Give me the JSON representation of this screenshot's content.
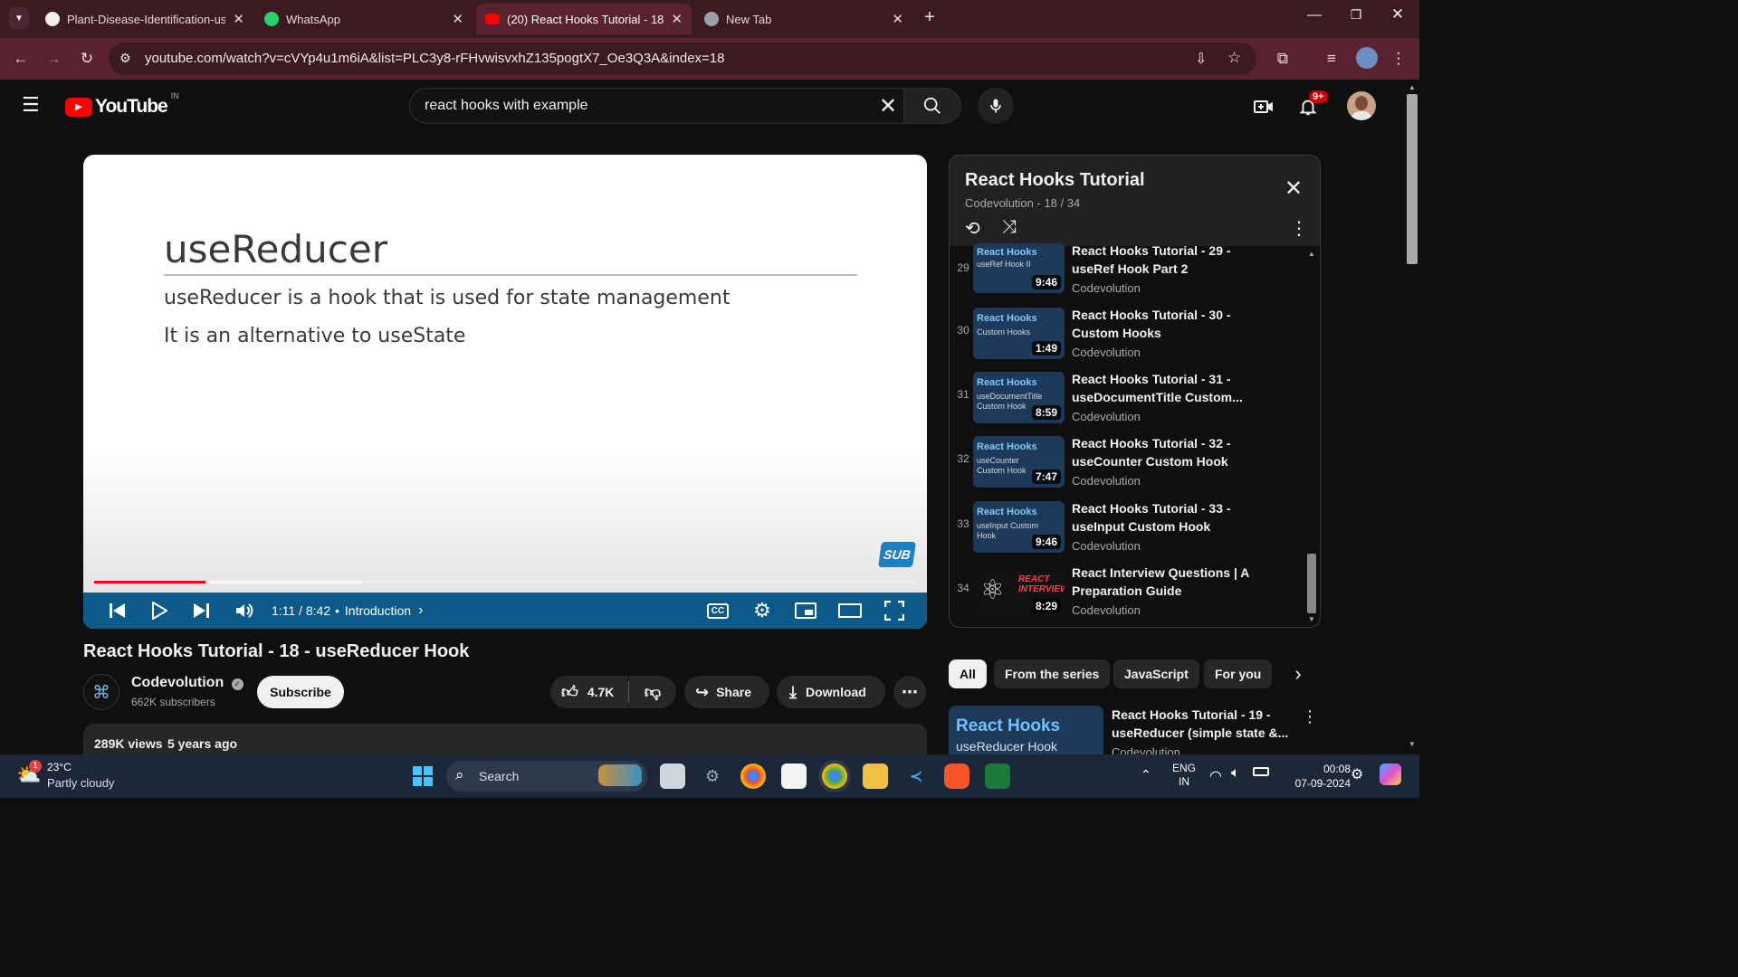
{
  "browser": {
    "tabs": [
      {
        "title": "Plant-Disease-Identification-usi",
        "icon": "github-icon"
      },
      {
        "title": "WhatsApp",
        "icon": "whatsapp-icon"
      },
      {
        "title": "(20) React Hooks Tutorial - 18 -",
        "icon": "youtube-icon"
      },
      {
        "title": "New Tab",
        "icon": "chrome-icon"
      }
    ],
    "url": "youtube.com/watch?v=cVYp4u1m6iA&list=PLC3y8-rFHvwisvxhZ135pogtX7_Oe3Q3A&index=18"
  },
  "header": {
    "logo_text": "YouTube",
    "region": "IN",
    "search_value": "react hooks with example",
    "notification_badge": "9+"
  },
  "player": {
    "slide_title": "useReducer",
    "slide_line1": "useReducer is a hook that is used for state management",
    "slide_line2": "It is an alternative to useState",
    "time": "1:11 / 8:42",
    "chapter": "Introduction",
    "watermark": "SUB",
    "progress": 0.136,
    "buffered": 0.325
  },
  "video": {
    "title": "React Hooks Tutorial - 18 - useReducer Hook",
    "channel": "Codevolution",
    "subscribers": "662K subscribers",
    "subscribe_label": "Subscribe",
    "likes": "4.7K",
    "share_label": "Share",
    "download_label": "Download",
    "views": "289K views",
    "age": "5 years ago"
  },
  "playlist": {
    "title": "React Hooks Tutorial",
    "meta": "Codevolution - 18 / 34",
    "items": [
      {
        "num": "29",
        "thumb_title": "React Hooks",
        "thumb_sub": "useRef Hook II",
        "duration": "9:46",
        "title": "React Hooks Tutorial - 29 - useRef Hook Part 2",
        "channel": "Codevolution"
      },
      {
        "num": "30",
        "thumb_title": "React Hooks",
        "thumb_sub": "Custom Hooks",
        "duration": "1:49",
        "title": "React Hooks Tutorial - 30 - Custom Hooks",
        "channel": "Codevolution"
      },
      {
        "num": "31",
        "thumb_title": "React Hooks",
        "thumb_sub": "useDocumentTitle Custom Hook",
        "duration": "8:59",
        "title": "React Hooks Tutorial - 31 - useDocumentTitle Custom...",
        "channel": "Codevolution"
      },
      {
        "num": "32",
        "thumb_title": "React Hooks",
        "thumb_sub": "useCounter Custom Hook",
        "duration": "7:47",
        "title": "React Hooks Tutorial - 32 - useCounter Custom Hook",
        "channel": "Codevolution"
      },
      {
        "num": "33",
        "thumb_title": "React Hooks",
        "thumb_sub": "useInput Custom Hook",
        "duration": "9:46",
        "title": "React Hooks Tutorial - 33 - useInput Custom Hook",
        "channel": "Codevolution"
      },
      {
        "num": "34",
        "thumb_title": "REACT INTERVIEW",
        "thumb_sub": "",
        "duration": "8:29",
        "title": "React Interview Questions | A Preparation Guide",
        "channel": "Codevolution"
      }
    ]
  },
  "chips": [
    "All",
    "From the series",
    "JavaScript",
    "For you"
  ],
  "recommended": {
    "thumb_title": "React Hooks",
    "thumb_sub": "useReducer Hook",
    "title": "React Hooks Tutorial - 19 - useReducer (simple state &...",
    "channel": "Codevolution"
  },
  "taskbar": {
    "temperature": "23°C",
    "weather": "Partly cloudy",
    "weather_badge": "1",
    "search_label": "Search",
    "lang1": "ENG",
    "lang2": "IN",
    "time": "00:08",
    "date": "07-09-2024"
  },
  "colors": {
    "accent_red": "#ff0000",
    "browser_frame": "#3b1a22",
    "toolbar": "#5a2230",
    "page_bg": "#0f0f0f",
    "player_controls": "#0b5a8a"
  }
}
